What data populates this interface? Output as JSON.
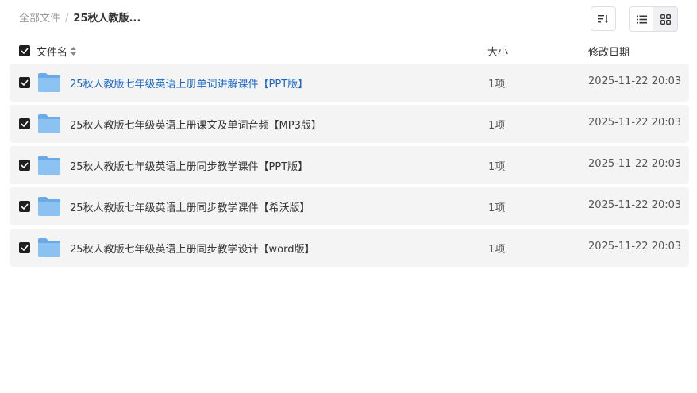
{
  "breadcrumb": {
    "root": "全部文件",
    "separator": "/",
    "current": "25秋人教版..."
  },
  "toolbar": {
    "sort_icon": "sort-icon",
    "list_view_icon": "list-view-icon",
    "grid_view_icon": "grid-view-icon",
    "active_view": "list"
  },
  "table": {
    "columns": {
      "name": "文件名",
      "size": "大小",
      "modified": "修改日期"
    },
    "rows": [
      {
        "name": "25秋人教版七年级英语上册单词讲解课件【PPT版】",
        "size": "1项",
        "modified": "2025-11-22 20:03",
        "checked": true
      },
      {
        "name": "25秋人教版七年级英语上册课文及单词音频【MP3版】",
        "size": "1项",
        "modified": "2025-11-22 20:03",
        "checked": true
      },
      {
        "name": "25秋人教版七年级英语上册同步教学课件【PPT版】",
        "size": "1项",
        "modified": "2025-11-22 20:03",
        "checked": true
      },
      {
        "name": "25秋人教版七年级英语上册同步教学课件【希沃版】",
        "size": "1项",
        "modified": "2025-11-22 20:03",
        "checked": true
      },
      {
        "name": "25秋人教版七年级英语上册同步教学设计【word版】",
        "size": "1项",
        "modified": "2025-11-22 20:03",
        "checked": true
      }
    ]
  },
  "colors": {
    "row_bg": "#f4f4f5",
    "link": "#1a66c9",
    "checkbox": "#1f1f1f",
    "folder": "#7fb8ee"
  }
}
